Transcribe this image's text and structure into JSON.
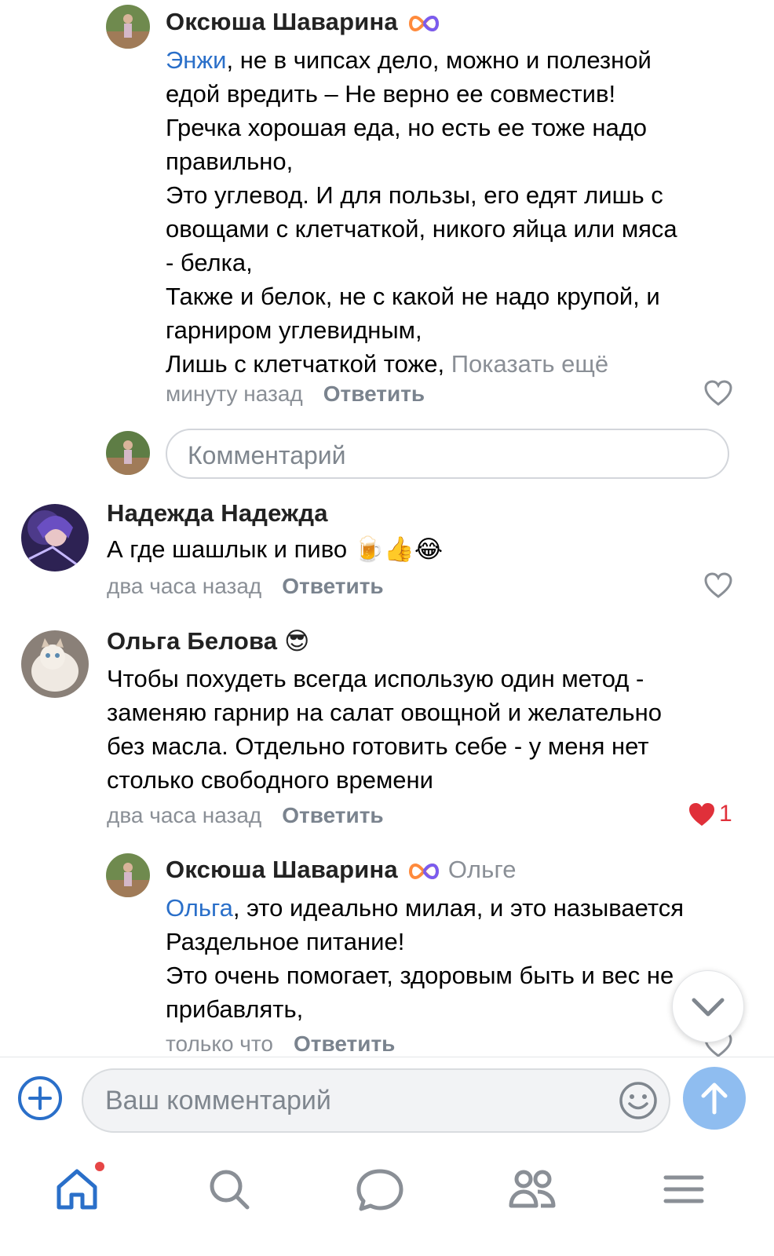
{
  "comments": [
    {
      "author": "Оксюша Шаварина",
      "text_lines": [
        {
          "mention": "Энжи",
          "rest": ", не в чипсах дело, можно и полезной"
        },
        {
          "rest": "едой вредить – Не верно ее совместив!"
        },
        {
          "rest": "Гречка хорошая еда, но есть ее тоже надо"
        },
        {
          "rest": "правильно,"
        },
        {
          "rest": "Это углевод. И для пользы, его едят лишь с"
        },
        {
          "rest": "овощами с клетчаткой, никого яйца или мяса"
        },
        {
          "rest": "- белка,"
        },
        {
          "rest": "Также и белок, не с какой не надо крупой, и"
        },
        {
          "rest": "гарниром углевидным,"
        },
        {
          "rest": "Лишь с клетчаткой тоже, "
        }
      ],
      "show_more": "Показать ещё",
      "time": "минуту назад",
      "reply_label": "Ответить"
    },
    {
      "author": "Надежда Надежда",
      "text": "А где шашлык и пиво",
      "emoji": "🍺👍😂",
      "time": "два часа назад",
      "reply_label": "Ответить"
    },
    {
      "author": "Ольга Белова",
      "author_emoji": "😎",
      "text_lines": [
        "Чтобы похудеть всегда использую один метод -",
        "заменяю гарнир на салат овощной и желательно",
        "без масла. Отдельно готовить себе - у меня нет",
        "столько свободного времени"
      ],
      "time": "два часа назад",
      "reply_label": "Ответить",
      "likes": "1"
    },
    {
      "author": "Оксюша Шаварина",
      "reply_to": "Ольге",
      "text_lines": [
        {
          "mention": "Ольга",
          "rest": ", это идеально милая, и это называется"
        },
        {
          "rest": "Раздельное питание!"
        },
        {
          "rest": "Это очень помогает, здоровым быть и вес не"
        },
        {
          "rest": "прибавлять,"
        }
      ],
      "time": "только что",
      "reply_label": "Ответить"
    }
  ],
  "comment_box": {
    "placeholder": "Комментарий"
  },
  "composer": {
    "placeholder": "Ваш комментарий"
  },
  "tabbar": {
    "items": [
      "home-icon",
      "search-icon",
      "messages-icon",
      "friends-icon",
      "menu-icon"
    ],
    "home_has_notification": true
  },
  "colors": {
    "accent": "#2a6fc9",
    "muted": "#8a8f96",
    "like_active": "#e0303a",
    "send_button": "#8fbdf0"
  }
}
